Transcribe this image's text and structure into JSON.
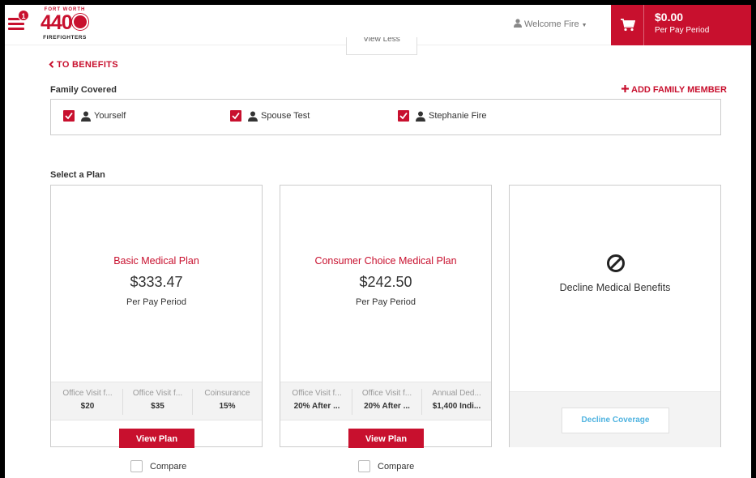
{
  "header": {
    "menu_badge": "1",
    "logo": {
      "top_text": "FORT WORTH",
      "number": "440",
      "bottom_text": "FIREFIGHTERS"
    },
    "view_less_label": "View Less",
    "welcome_text": "Welcome Fire",
    "cart": {
      "total": "$0.00",
      "subtitle": "Per Pay Period"
    }
  },
  "back_link": "TO BENEFITS",
  "family": {
    "title": "Family Covered",
    "add_label": "ADD FAMILY MEMBER",
    "members": [
      {
        "name": "Yourself",
        "checked": true
      },
      {
        "name": "Spouse Test",
        "checked": true
      },
      {
        "name": "Stephanie Fire",
        "checked": true
      }
    ]
  },
  "plans_section_title": "Select a Plan",
  "plans": [
    {
      "name": "Basic Medical Plan",
      "price": "$333.47",
      "period": "Per Pay Period",
      "stats": [
        {
          "label": "Office Visit f...",
          "value": "$20"
        },
        {
          "label": "Office Visit f...",
          "value": "$35"
        },
        {
          "label": "Coinsurance",
          "value": "15%"
        }
      ],
      "view_label": "View Plan",
      "compare_label": "Compare"
    },
    {
      "name": "Consumer Choice Medical Plan",
      "price": "$242.50",
      "period": "Per Pay Period",
      "stats": [
        {
          "label": "Office Visit f...",
          "value": "20% After ..."
        },
        {
          "label": "Office Visit f...",
          "value": "20% After ..."
        },
        {
          "label": "Annual Ded...",
          "value": "$1,400 Indi..."
        }
      ],
      "view_label": "View Plan",
      "compare_label": "Compare"
    }
  ],
  "decline": {
    "title": "Decline Medical Benefits",
    "button_label": "Decline Coverage"
  },
  "colors": {
    "brand_red": "#c8102e",
    "link_blue": "#4fb3e0"
  }
}
